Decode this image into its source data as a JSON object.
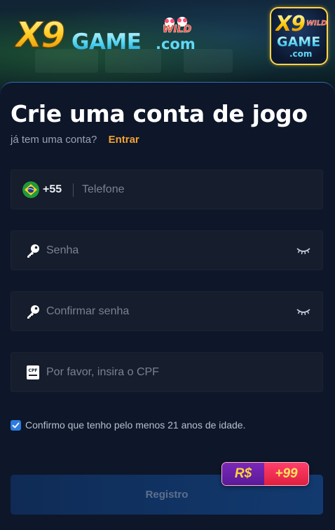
{
  "header": {
    "logo_x9": "X9",
    "logo_game": "GAME",
    "logo_com": ".com",
    "logo_wild": "WILD",
    "app_icon": {
      "x9": "X9",
      "wild": "WILD",
      "game": "GAME",
      "com": ".com"
    }
  },
  "form": {
    "title": "Crie uma conta de jogo",
    "login_prompt": "já tem uma conta?",
    "login_link": "Entrar",
    "phone": {
      "country_code": "+55",
      "placeholder": "Telefone",
      "flag": "brazil-flag"
    },
    "password": {
      "placeholder": "Senha",
      "icon": "key-icon"
    },
    "confirm_password": {
      "placeholder": "Confirmar senha",
      "icon": "key-icon"
    },
    "cpf": {
      "placeholder": "Por favor, insira o CPF",
      "icon": "cpf-card-icon",
      "icon_text": "CPF"
    },
    "age_confirm": {
      "label": "Confirmo que tenho pelo menos 21 anos de idade.",
      "checked": true
    },
    "register_button": "Registro",
    "bonus": {
      "currency": "R$",
      "amount": "+99"
    }
  },
  "colors": {
    "accent_link": "#f2a234",
    "checkbox": "#2d7be2",
    "background": "#0e1629"
  }
}
